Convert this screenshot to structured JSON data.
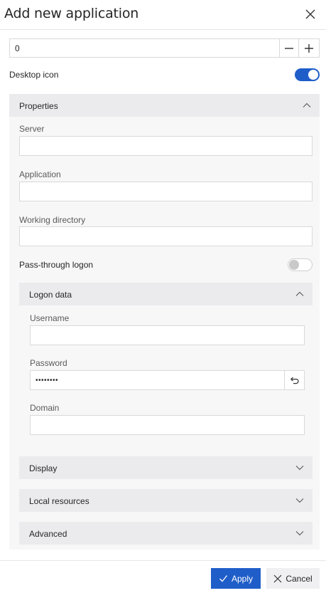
{
  "dialog": {
    "title": "Add new application"
  },
  "number_field": {
    "value": "0"
  },
  "desktop_icon": {
    "label": "Desktop icon",
    "enabled": true
  },
  "properties": {
    "label": "Properties",
    "server": {
      "label": "Server",
      "value": ""
    },
    "application": {
      "label": "Application",
      "value": ""
    },
    "working_directory": {
      "label": "Working directory",
      "value": ""
    },
    "pass_through": {
      "label": "Pass-through logon",
      "enabled": false
    },
    "logon_data": {
      "label": "Logon data",
      "username": {
        "label": "Username",
        "value": ""
      },
      "password": {
        "label": "Password",
        "value": "••••••••"
      },
      "domain": {
        "label": "Domain",
        "value": ""
      }
    }
  },
  "sections": {
    "display": "Display",
    "local_resources": "Local resources",
    "advanced": "Advanced"
  },
  "footer": {
    "apply": "Apply",
    "cancel": "Cancel"
  },
  "colors": {
    "accent": "#1f5ec9",
    "section_bg": "#ebebee",
    "panel_bg": "#f7f7f8"
  }
}
